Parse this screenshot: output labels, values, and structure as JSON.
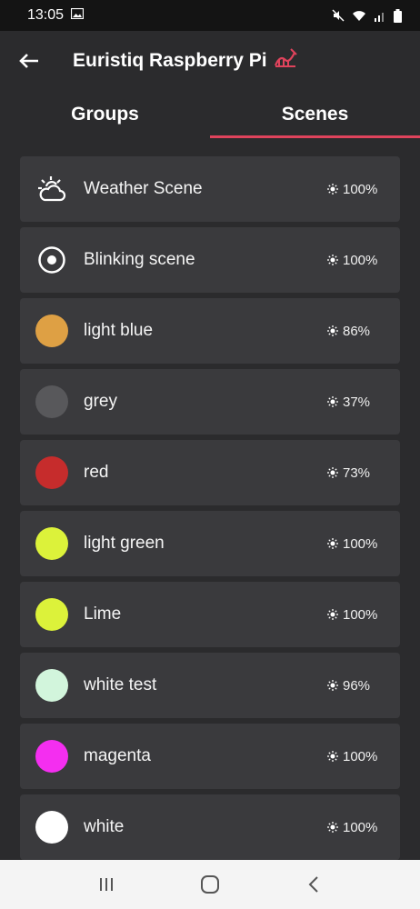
{
  "status_bar": {
    "time": "13:05"
  },
  "app_bar": {
    "title": "Euristiq Raspberry Pi"
  },
  "tabs": [
    {
      "label": "Groups",
      "active": false
    },
    {
      "label": "Scenes",
      "active": true
    }
  ],
  "accent_color": "#e0435c",
  "scenes": [
    {
      "label": "Weather Scene",
      "brightness": "100%",
      "icon": "weather-icon"
    },
    {
      "label": "Blinking scene",
      "brightness": "100%",
      "icon": "blinking-icon"
    },
    {
      "label": "light blue",
      "brightness": "86%",
      "color": "#dea044"
    },
    {
      "label": "grey",
      "brightness": "37%",
      "color": "#58585b"
    },
    {
      "label": "red",
      "brightness": "73%",
      "color": "#c62c2c"
    },
    {
      "label": "light green",
      "brightness": "100%",
      "color": "#dcf23a"
    },
    {
      "label": "Lime",
      "brightness": "100%",
      "color": "#dcf23a"
    },
    {
      "label": "white test",
      "brightness": "96%",
      "color": "#d2f5dc"
    },
    {
      "label": "magenta",
      "brightness": "100%",
      "color": "#f42ef0"
    },
    {
      "label": "white",
      "brightness": "100%",
      "color": "#ffffff"
    }
  ]
}
